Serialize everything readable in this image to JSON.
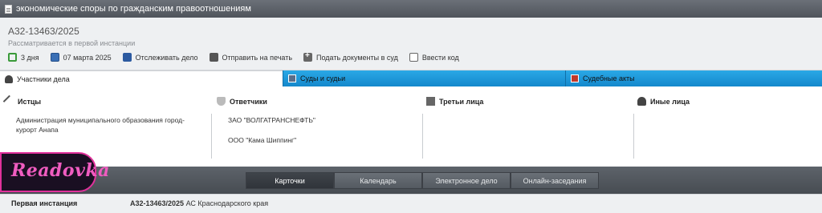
{
  "window": {
    "title": "экономические споры по гражданским правоотношениям",
    "icon": "document-icon"
  },
  "case": {
    "number": "А32-13463/2025",
    "status": "Рассматривается в первой инстанции"
  },
  "actions": [
    {
      "icon": "clock-icon",
      "label": "3 дня"
    },
    {
      "icon": "calendar-icon",
      "label": "07 марта 2025"
    },
    {
      "icon": "shield-icon",
      "label": "Отслеживать дело"
    },
    {
      "icon": "printer-icon",
      "label": "Отправить на печать"
    },
    {
      "icon": "plus-icon",
      "label": "Подать документы в суд"
    },
    {
      "icon": "keyboard-icon",
      "label": "Ввести код"
    }
  ],
  "tabs": [
    {
      "icon": "person-icon",
      "label": "Участники дела",
      "active": true
    },
    {
      "icon": "court-icon",
      "label": "Суды и судьи",
      "active": false
    },
    {
      "icon": "acts-icon",
      "label": "Судебные акты",
      "active": false
    }
  ],
  "participants": {
    "plaintiffs": {
      "icon": "gavel-icon",
      "header": "Истцы",
      "items": [
        "Администрация муниципального образования город-",
        "курорт Анапа"
      ]
    },
    "defendants": {
      "icon": "shield-icon",
      "header": "Ответчики",
      "items": [
        "ЗАО \"ВОЛГАТРАНСНЕФТЬ\"",
        "ООО \"Кама Шиппинг\""
      ]
    },
    "third_parties": {
      "icon": "factory-icon",
      "header": "Третьи лица",
      "items": []
    },
    "others": {
      "icon": "person-icon",
      "header": "Иные лица",
      "items": []
    }
  },
  "bottom_tabs": [
    "Карточки",
    "Календарь",
    "Электронное дело",
    "Онлайн-заседания"
  ],
  "footer": {
    "instance_label": "Первая инстанция",
    "case_number": "А32-13463/2025",
    "court": "АС Краснодарского края"
  },
  "watermark": {
    "text": "Readovka"
  },
  "colors": {
    "tab_blue": "#1a9ad9",
    "topbar": "#5a5f66",
    "logo_pink": "#e0319b"
  }
}
